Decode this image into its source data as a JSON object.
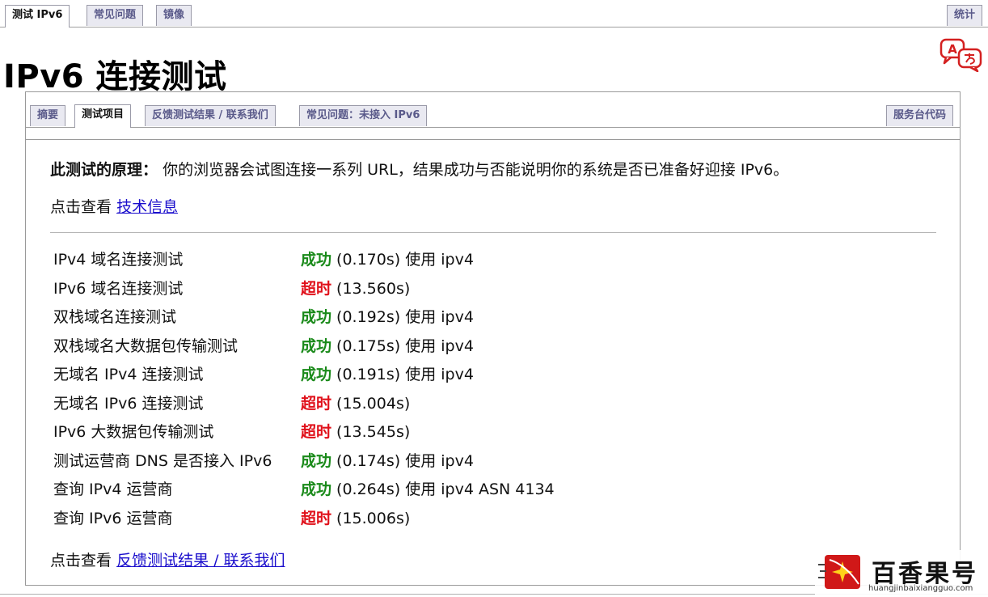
{
  "top_tabs": {
    "test_ipv6": "测试 IPv6",
    "faq": "常见问题",
    "mirror": "镜像",
    "stats": "统计"
  },
  "page_title": "IPv6 连接测试",
  "sub_tabs": {
    "summary": "摘要",
    "test_items": "测试项目",
    "feedback": "反馈测试结果 / 联系我们",
    "faq_no_ipv6": "常见问题：未接入 IPv6",
    "helpdesk_code": "服务台代码"
  },
  "principle": {
    "label": "此测试的原理：",
    "text": "你的浏览器会试图连接一系列 URL，结果成功与否能说明你的系统是否已准备好迎接 IPv6。"
  },
  "tech_info": {
    "prefix": "点击查看",
    "link": "技术信息"
  },
  "results": [
    {
      "name": "IPv4 域名连接测试",
      "status": "成功",
      "ok": true,
      "detail": " (0.170s) 使用 ipv4"
    },
    {
      "name": "IPv6 域名连接测试",
      "status": "超时",
      "ok": false,
      "detail": " (13.560s)"
    },
    {
      "name": "双栈域名连接测试",
      "status": "成功",
      "ok": true,
      "detail": " (0.192s) 使用 ipv4"
    },
    {
      "name": "双栈域名大数据包传输测试",
      "status": "成功",
      "ok": true,
      "detail": " (0.175s) 使用 ipv4"
    },
    {
      "name": "无域名 IPv4 连接测试",
      "status": "成功",
      "ok": true,
      "detail": " (0.191s) 使用 ipv4"
    },
    {
      "name": "无域名 IPv6 连接测试",
      "status": "超时",
      "ok": false,
      "detail": " (15.004s)"
    },
    {
      "name": "IPv6 大数据包传输测试",
      "status": "超时",
      "ok": false,
      "detail": " (13.545s)"
    },
    {
      "name": "测试运营商 DNS 是否接入 IPv6",
      "status": "成功",
      "ok": true,
      "detail": " (0.174s) 使用 ipv4"
    },
    {
      "name": "查询 IPv4 运营商",
      "status": "成功",
      "ok": true,
      "detail": " (0.264s) 使用 ipv4 ASN 4134"
    },
    {
      "name": "查询 IPv6 运营商",
      "status": "超时",
      "ok": false,
      "detail": " (15.006s)"
    }
  ],
  "feedback_line": {
    "prefix": "点击查看",
    "link": "反馈测试结果 / 联系我们"
  },
  "watermark": {
    "title": "百香果号",
    "url": "huangjinbaixiangguo.com"
  },
  "colors": {
    "success": "#1a8a1a",
    "timeout": "#e0101a",
    "link": "#1a0dcc",
    "tab_text": "#5a5a8a"
  },
  "icons": {
    "translate": "translate-icon",
    "watermark_logo": "star-logo-icon"
  }
}
